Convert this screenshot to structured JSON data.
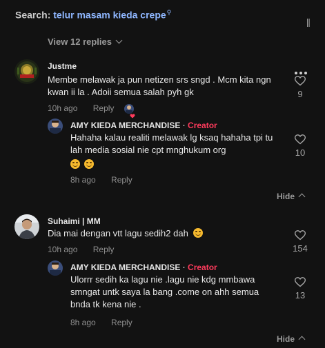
{
  "search": {
    "label": "Search:",
    "query": "telur masam kieda crepe"
  },
  "thread": {
    "view_replies": "View 12 replies"
  },
  "comments": [
    {
      "username": "Justme",
      "text": "Membe melawak ja pun netizen srs sngd . Mcm kita ngn kwan ii la . Adoii semua salah pyh gk",
      "time": "10h ago",
      "reply": "Reply",
      "likes": "9",
      "replies": [
        {
          "username": "AMY KIEDA MERCHANDISE",
          "dot": "·",
          "badge": "Creator",
          "text": "Hahaha kalau realiti melawak lg ksaq hahaha tpi tu lah media sosial nie cpt mnghukum org",
          "time": "8h ago",
          "reply": "Reply",
          "likes": "10"
        }
      ],
      "hide": "Hide"
    },
    {
      "username": "Suhaimi | MM",
      "text": "Dia mai dengan vtt lagu sedih2 dah",
      "time": "10h ago",
      "reply": "Reply",
      "likes": "154",
      "replies": [
        {
          "username": "AMY KIEDA MERCHANDISE",
          "dot": "·",
          "badge": "Creator",
          "text": "Ulorrr sedih ka lagu nie .lagu nie kdg mmbawa smngat untk saya la bang .come on ahh semua bnda tk kena nie .",
          "time": "8h ago",
          "reply": "Reply",
          "likes": "13"
        }
      ],
      "hide": "Hide"
    }
  ],
  "colors": {
    "background": "#121212",
    "creator_badge": "#ff3b5c",
    "search_query": "#8fb7ff"
  }
}
